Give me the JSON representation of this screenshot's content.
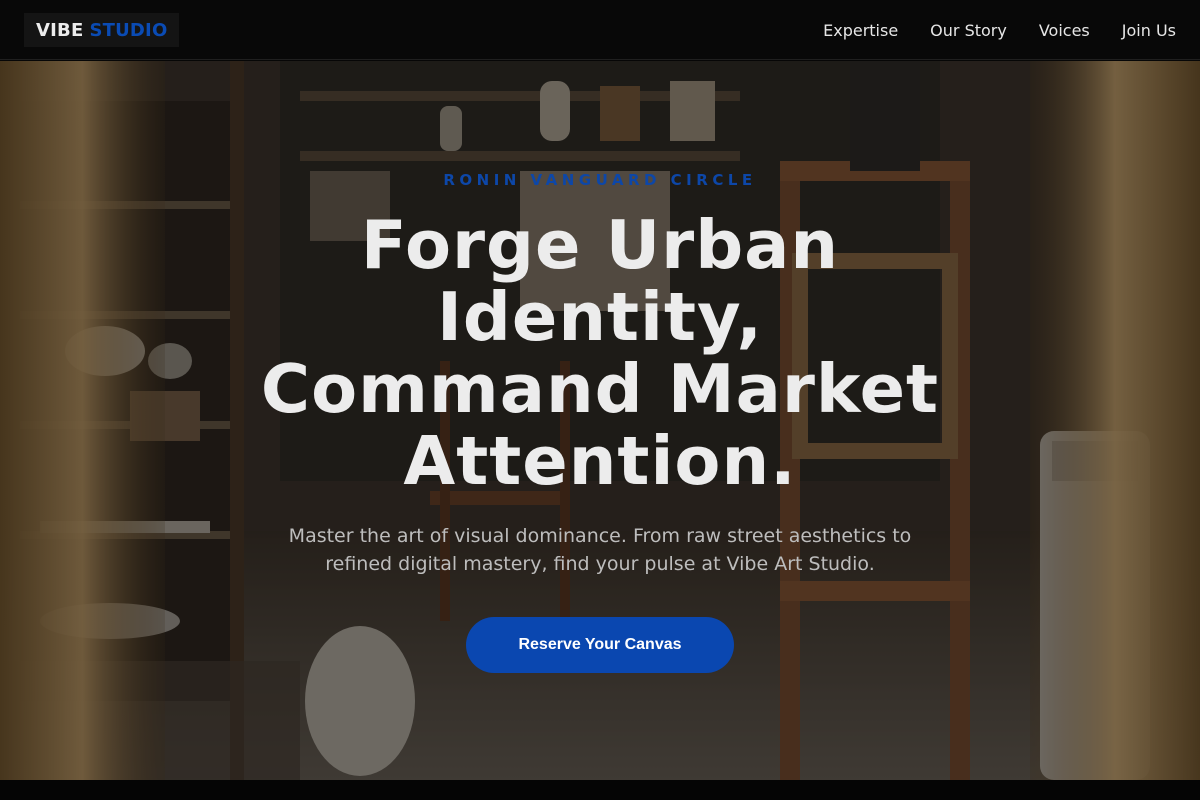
{
  "brand": {
    "part1": "VIBE",
    "part2": "STUDIO",
    "accent_color": "#0a4bb4"
  },
  "nav": {
    "items": [
      {
        "label": "Expertise"
      },
      {
        "label": "Our Story"
      },
      {
        "label": "Voices"
      },
      {
        "label": "Join Us"
      }
    ]
  },
  "hero": {
    "eyebrow": "RONIN VANGUARD CIRCLE",
    "headline": "Forge Urban\nIdentity,\nCommand Market\nAttention.",
    "subtitle": "Master the art of visual dominance. From raw street aesthetics to\nrefined digital mastery, find your pulse at Vibe Art Studio.",
    "cta_label": "Reserve Your Canvas",
    "background_image": "art-studio-workshop-photo"
  },
  "colors": {
    "accent": "#0a47b0",
    "text": "#ececec",
    "background": "#080808"
  }
}
